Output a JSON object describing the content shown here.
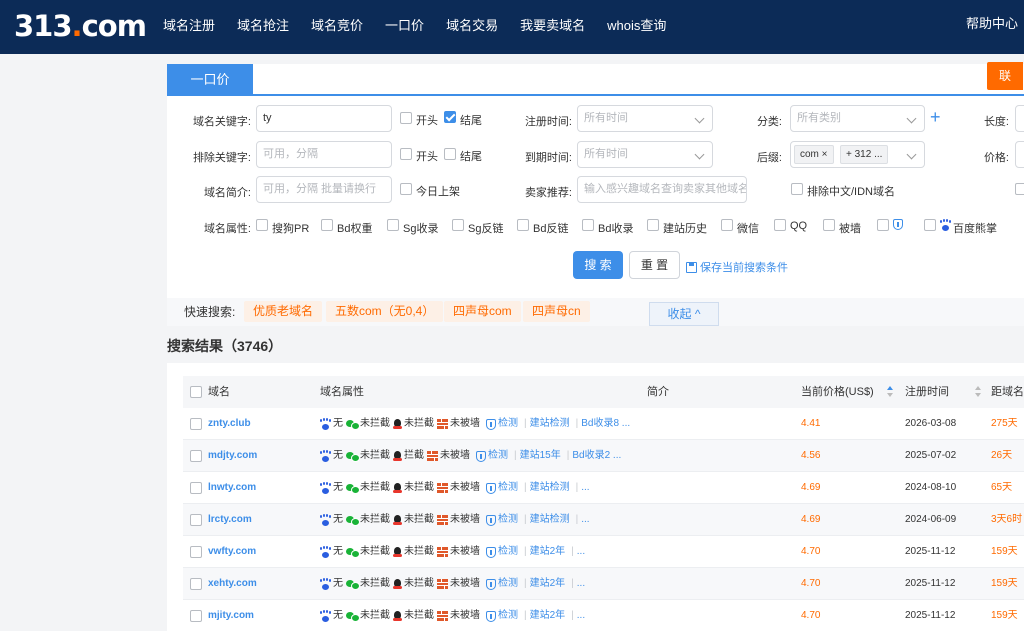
{
  "header": {
    "logo_main": "313",
    "logo_dot": ".",
    "logo_suffix": "com",
    "nav": [
      "域名注册",
      "域名抢注",
      "域名竞价",
      "一口价",
      "域名交易",
      "我要卖域名",
      "whois查询"
    ],
    "help": "帮助中心"
  },
  "tabs": {
    "active": "一口价",
    "right_partial": "联"
  },
  "filters": {
    "keyword_label": "域名关键字:",
    "keyword_value": "ty",
    "keyword_start": "开头",
    "keyword_end": "结尾",
    "keyword_end_checked": true,
    "exclude_label": "排除关键字:",
    "exclude_placeholder": "可用，分隔",
    "exclude_start": "开头",
    "exclude_end": "结尾",
    "intro_label": "域名简介:",
    "intro_placeholder": "可用，分隔 批量请换行",
    "today_listed": "今日上架",
    "reg_time_label": "注册时间:",
    "reg_time_placeholder": "所有时间",
    "exp_time_label": "到期时间:",
    "exp_time_placeholder": "所有时间",
    "seller_label": "卖家推荐:",
    "seller_placeholder": "输入感兴趣域名查询卖家其他域名",
    "category_label": "分类:",
    "category_placeholder": "所有类别",
    "suffix_label": "后缀:",
    "suffix_tags": [
      "com",
      "+ 312 ..."
    ],
    "exclude_idn": "排除中文/IDN域名",
    "length_label": "长度:",
    "price_label": "价格:",
    "attr_label": "域名属性:",
    "attrs": [
      "搜狗PR",
      "Bd权重",
      "Sg收录",
      "Sg反链",
      "Bd反链",
      "Bd收录",
      "建站历史",
      "微信",
      "QQ",
      "被墙",
      "",
      "百度熊掌"
    ]
  },
  "buttons": {
    "search": "搜 索",
    "reset": "重 置",
    "save": "保存当前搜索条件",
    "collapse": "收起 ^"
  },
  "quick": {
    "label": "快速搜索:",
    "tags": [
      "优质老域名",
      "五数com（无0,4）",
      "四声母com",
      "四声母cn"
    ]
  },
  "results": {
    "title": "搜索结果（3746）"
  },
  "table": {
    "headers": [
      "域名",
      "域名属性",
      "简介",
      "当前价格(US$)",
      "注册时间",
      "距域名"
    ],
    "rows": [
      {
        "domain": "znty.club",
        "baidu": "无",
        "wx": "未拦截",
        "qq": "未拦截",
        "wall": "未被墙",
        "check": "检测",
        "extra1": "建站检测",
        "extra2": "Bd收录8 ...",
        "price": "4.41",
        "reg": "2026-03-08",
        "days": "275天"
      },
      {
        "domain": "mdjty.com",
        "baidu": "无",
        "wx": "未拦截",
        "qq": "拦截",
        "wall": "未被墙",
        "check": "检测",
        "extra1": "建站15年",
        "extra2": "Bd收录2 ...",
        "price": "4.56",
        "reg": "2025-07-02",
        "days": "26天"
      },
      {
        "domain": "lnwty.com",
        "baidu": "无",
        "wx": "未拦截",
        "qq": "未拦截",
        "wall": "未被墙",
        "check": "检测",
        "extra1": "建站检测",
        "extra2": "...",
        "price": "4.69",
        "reg": "2024-08-10",
        "days": "65天"
      },
      {
        "domain": "lrcty.com",
        "baidu": "无",
        "wx": "未拦截",
        "qq": "未拦截",
        "wall": "未被墙",
        "check": "检测",
        "extra1": "建站检测",
        "extra2": "...",
        "price": "4.69",
        "reg": "2024-06-09",
        "days": "3天6时"
      },
      {
        "domain": "vwfty.com",
        "baidu": "无",
        "wx": "未拦截",
        "qq": "未拦截",
        "wall": "未被墙",
        "check": "检测",
        "extra1": "建站2年",
        "extra2": "...",
        "price": "4.70",
        "reg": "2025-11-12",
        "days": "159天"
      },
      {
        "domain": "xehty.com",
        "baidu": "无",
        "wx": "未拦截",
        "qq": "未拦截",
        "wall": "未被墙",
        "check": "检测",
        "extra1": "建站2年",
        "extra2": "...",
        "price": "4.70",
        "reg": "2025-11-12",
        "days": "159天"
      },
      {
        "domain": "mjity.com",
        "baidu": "无",
        "wx": "未拦截",
        "qq": "未拦截",
        "wall": "未被墙",
        "check": "检测",
        "extra1": "建站2年",
        "extra2": "...",
        "price": "4.70",
        "reg": "2025-11-12",
        "days": "159天"
      }
    ]
  },
  "colors": {
    "nav_bg": "#0c2b57",
    "accent": "#3d8ee8",
    "orange": "#ff6a00"
  }
}
